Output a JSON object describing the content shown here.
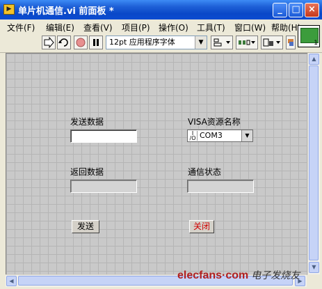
{
  "window": {
    "title": "单片机通信.vi 前面板 *"
  },
  "menu": [
    "文件(F)",
    "编辑(E)",
    "查看(V)",
    "项目(P)",
    "操作(O)",
    "工具(T)",
    "窗口(W)",
    "帮助(H)"
  ],
  "toolbar": {
    "font": "12pt 应用程序字体"
  },
  "vi_icon": {
    "number": "1"
  },
  "panel": {
    "send_label": "发送数据",
    "send_value": "",
    "visa_label": "VISA资源名称",
    "visa_value": "COM3",
    "return_label": "返回数据",
    "return_value": "",
    "status_label": "通信状态",
    "status_value": "",
    "send_button": "发送",
    "close_button": "关闭"
  },
  "watermark": {
    "text": "elecfans·com",
    "text_cn": "电子发烧友"
  }
}
